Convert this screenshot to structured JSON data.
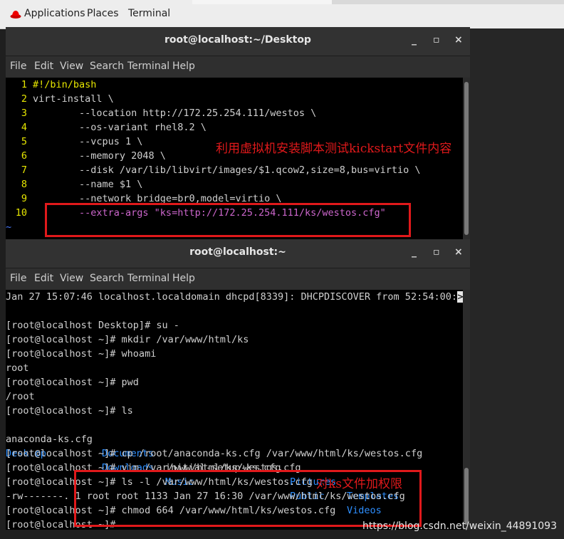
{
  "topbar": {
    "applications": "Applications",
    "places": "Places",
    "terminal": "Terminal"
  },
  "window1": {
    "title": "root@localhost:~/Desktop",
    "menu": [
      "File",
      "Edit",
      "View",
      "Search",
      "Terminal",
      "Help"
    ],
    "minimize": "_",
    "maximize": "▫",
    "close": "×",
    "lines": [
      {
        "n": "1",
        "text": "#!/bin/bash"
      },
      {
        "n": "2",
        "text": "virt-install \\"
      },
      {
        "n": "3",
        "text": "        --location http://172.25.254.111/westos \\"
      },
      {
        "n": "4",
        "text": "        --os-variant rhel8.2 \\"
      },
      {
        "n": "5",
        "text": "        --vcpus 1 \\"
      },
      {
        "n": "6",
        "text": "        --memory 2048 \\"
      },
      {
        "n": "7",
        "text": "        --disk /var/lib/libvirt/images/$1.qcow2,size=8,bus=virtio \\"
      },
      {
        "n": "8",
        "text": "        --name $1 \\"
      },
      {
        "n": "9",
        "text": "        --network bridge=br0,model=virtio \\"
      },
      {
        "n": "10",
        "text": "        --extra-args \"ks=http://172.25.254.111/ks/westos.cfg\""
      }
    ],
    "tilde": "~"
  },
  "window2": {
    "title": "root@localhost:~",
    "menu": [
      "File",
      "Edit",
      "View",
      "Search",
      "Terminal",
      "Help"
    ],
    "minimize": "_",
    "maximize": "▫",
    "close": "×",
    "log_line": "Jan 27 15:07:46 localhost.localdomain dhcpd[8339]: DHCPDISCOVER from 52:54:00:",
    "log_more": ">",
    "lines": [
      "",
      "[root@localhost Desktop]# su -",
      "[root@localhost ~]# mkdir /var/www/html/ks",
      "[root@localhost ~]# whoami",
      "root",
      "[root@localhost ~]# pwd",
      "/root",
      "[root@localhost ~]# ls"
    ],
    "ls_row1": {
      "a": "anaconda-ks.cfg",
      "b": "Documents",
      "c": "initial-setup-ks.cfg",
      "d": "Pictures",
      "e": "Templates"
    },
    "ls_row2": {
      "a": "Desktop",
      "b": "Downloads",
      "c": "Music",
      "d": "Public",
      "e": "Videos"
    },
    "lines_after": [
      "[root@localhost ~]# cp /root/anaconda-ks.cfg /var/www/html/ks/westos.cfg",
      "[root@localhost ~]# vim /var/www/html/ks/westos.cfg",
      "[root@localhost ~]# ls -l /var/www/html/ks/westos.cfg",
      "-rw-------. 1 root root 1133 Jan 27 16:30 /var/www/html/ks/westos.cfg",
      "[root@localhost ~]# chmod 664 /var/www/html/ks/westos.cfg",
      "[root@localhost ~]# "
    ]
  },
  "annotations": {
    "note1": "利用虚拟机安装脚本测试kickstart文件内容",
    "note2": "对ks文件加权限"
  },
  "watermark": "https://blog.csdn.net/weixin_44891093",
  "colors": {
    "annotation": "#e0191b",
    "line_numbers": "#e6e600",
    "string": "#cc66cc",
    "dir_blue": "#2e8fff"
  }
}
